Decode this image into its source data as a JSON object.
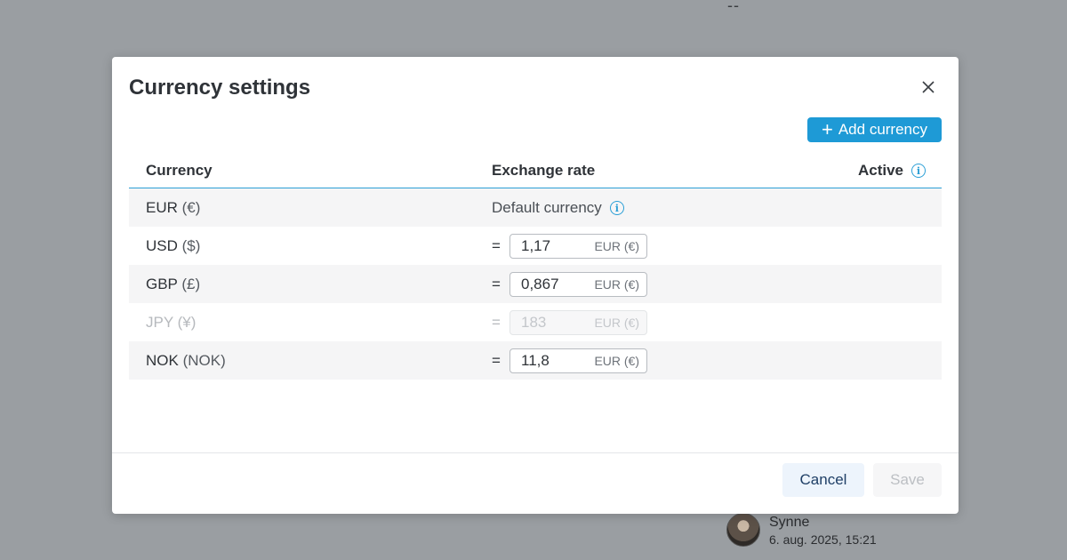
{
  "background": {
    "dashes": "--",
    "user": {
      "name": "Synne",
      "date": "6. aug. 2025, 15:21"
    }
  },
  "dialog": {
    "title": "Currency settings",
    "add_button": "Add currency",
    "columns": {
      "currency": "Currency",
      "rate": "Exchange rate",
      "active": "Active"
    },
    "default_label": "Default currency",
    "rows": [
      {
        "code": "EUR",
        "symbol": "(€)",
        "default": true
      },
      {
        "code": "USD",
        "symbol": "($)",
        "eq": "=",
        "rate": "1,17",
        "unit": "EUR (€)"
      },
      {
        "code": "GBP",
        "symbol": "(£)",
        "eq": "=",
        "rate": "0,867",
        "unit": "EUR (€)"
      },
      {
        "code": "JPY",
        "symbol": "(¥)",
        "eq": "=",
        "rate": "183",
        "unit": "EUR (€)",
        "disabled": true
      },
      {
        "code": "NOK",
        "symbol": "(NOK)",
        "eq": "=",
        "rate": "11,8",
        "unit": "EUR (€)"
      }
    ],
    "cancel_button": "Cancel",
    "save_button": "Save"
  },
  "colors": {
    "accent": "#1e9ad6",
    "backdrop": "#9a9ea2",
    "row_shade": "#f5f5f6"
  }
}
